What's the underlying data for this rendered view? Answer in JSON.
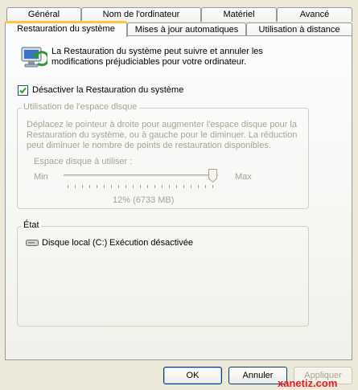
{
  "tabs_row1": [
    "Général",
    "Nom de l'ordinateur",
    "Matériel",
    "Avancé"
  ],
  "tabs_row2": [
    "Restauration du système",
    "Mises à jour automatiques",
    "Utilisation à distance"
  ],
  "intro_text": "La Restauration du système peut suivre et annuler les modifications préjudiciables pour votre ordinateur.",
  "disable_checkbox": {
    "label": "Désactiver la Restauration du système",
    "checked": true
  },
  "disk_usage": {
    "title": "Utilisation de l'espace disque",
    "description": "Déplacez le pointeur à droite pour augmenter l'espace disque pour la Restauration du système, ou à gauche pour le diminuer. La réduction peut diminuer le nombre de points de restauration disponibles.",
    "slider_label": "Espace disque à utiliser :",
    "min_label": "Min",
    "max_label": "Max",
    "slider_value": 1.0,
    "value_text": "12% (6733 MB)"
  },
  "status": {
    "title": "État",
    "drive_name": "Disque local (C:)",
    "drive_status": "Exécution désactivée"
  },
  "buttons": {
    "ok": "OK",
    "cancel": "Annuler",
    "apply": "Appliquer"
  },
  "watermark": "xanetiz.com"
}
